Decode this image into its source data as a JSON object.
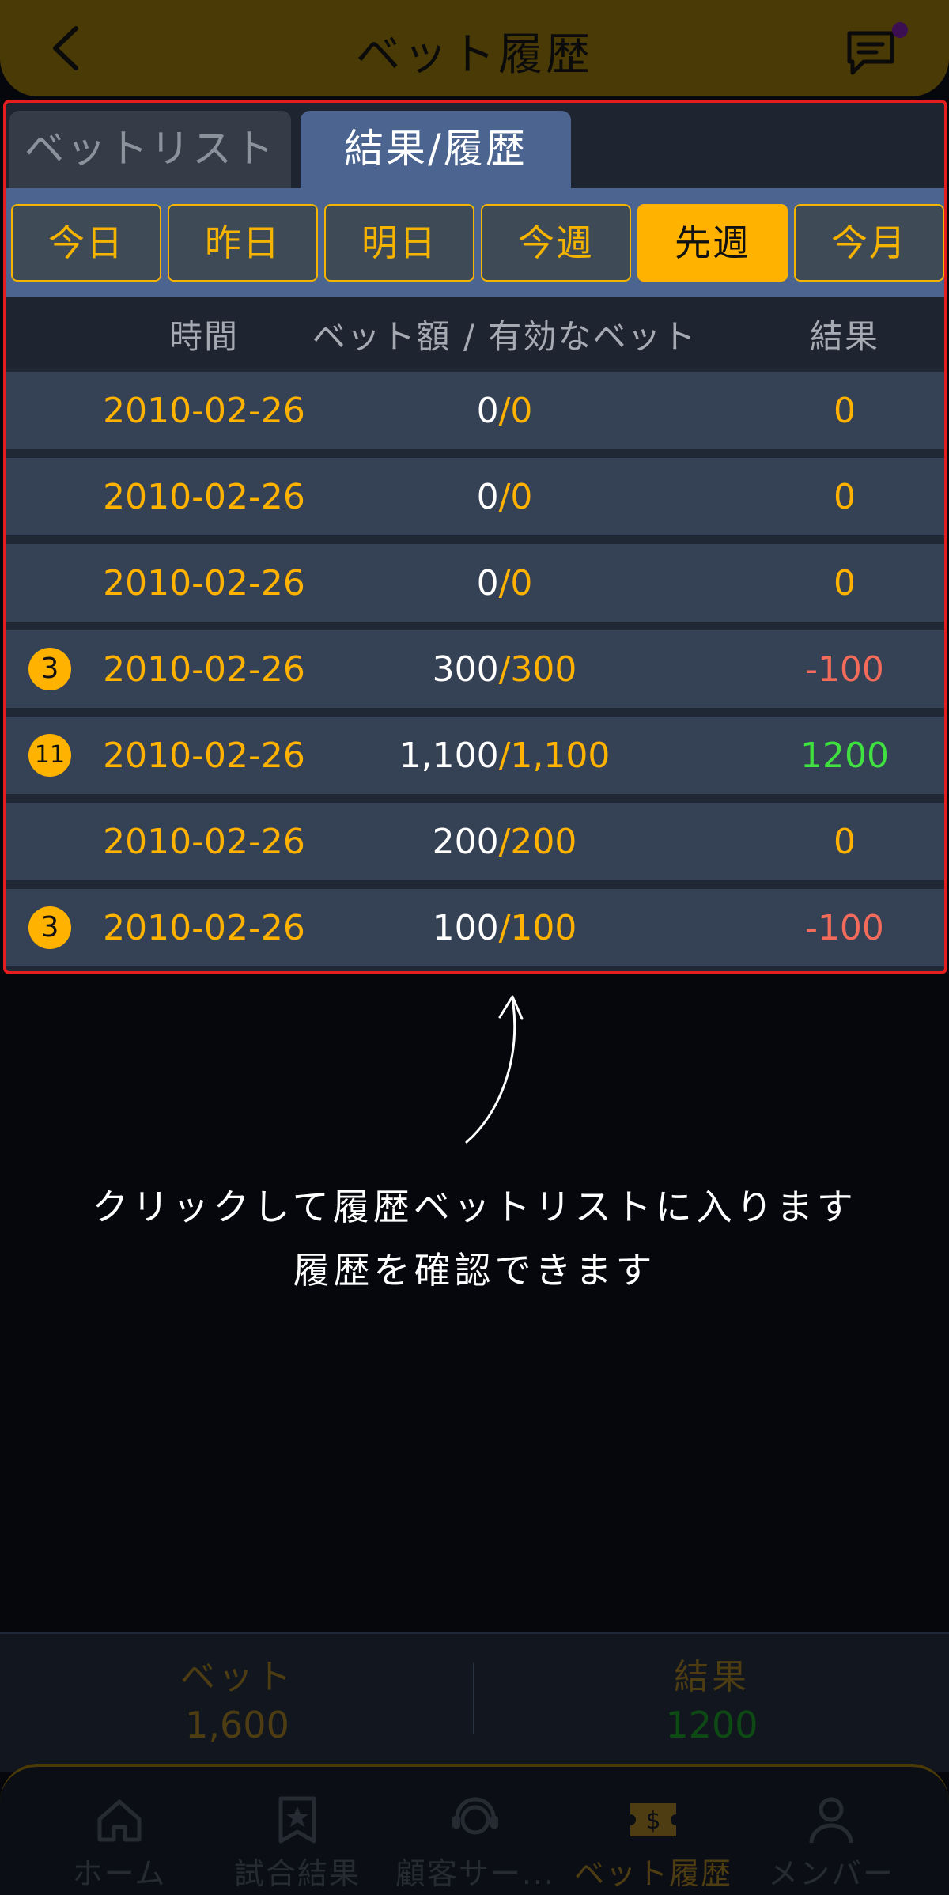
{
  "header": {
    "title": "ベット履歴"
  },
  "tabs": [
    {
      "label": "ベットリスト",
      "active": false
    },
    {
      "label": "結果/履歴",
      "active": true
    }
  ],
  "filters": [
    {
      "label": "今日",
      "active": false
    },
    {
      "label": "昨日",
      "active": false
    },
    {
      "label": "明日",
      "active": false
    },
    {
      "label": "今週",
      "active": false
    },
    {
      "label": "先週",
      "active": true
    },
    {
      "label": "今月",
      "active": false
    }
  ],
  "table": {
    "columns": {
      "time": "時間",
      "amount": "ベット額 / 有効なベット",
      "result": "結果"
    },
    "rows": [
      {
        "badge": "",
        "date": "2010-02-26",
        "total": "0",
        "valid": "0",
        "result": "0",
        "result_color": "#ffb300"
      },
      {
        "badge": "",
        "date": "2010-02-26",
        "total": "0",
        "valid": "0",
        "result": "0",
        "result_color": "#ffb300"
      },
      {
        "badge": "",
        "date": "2010-02-26",
        "total": "0",
        "valid": "0",
        "result": "0",
        "result_color": "#ffb300"
      },
      {
        "badge": "3",
        "date": "2010-02-26",
        "total": "300",
        "valid": "300",
        "result": "-100",
        "result_color": "#f26b5b"
      },
      {
        "badge": "11",
        "date": "2010-02-26",
        "total": "1,100",
        "valid": "1,100",
        "result": "1200",
        "result_color": "#3fe03f"
      },
      {
        "badge": "",
        "date": "2010-02-26",
        "total": "200",
        "valid": "200",
        "result": "0",
        "result_color": "#ffb300"
      },
      {
        "badge": "3",
        "date": "2010-02-26",
        "total": "100",
        "valid": "100",
        "result": "-100",
        "result_color": "#f26b5b"
      }
    ]
  },
  "hint": {
    "line1": "クリックして履歴ベットリストに入ります",
    "line2": "履歴を確認できます"
  },
  "summary": {
    "bet_label": "ベット",
    "bet_value": "1,600",
    "bet_color": "#4e3d12",
    "result_label": "結果",
    "result_value": "1200",
    "result_color": "#0e4a14"
  },
  "nav": [
    {
      "label": "ホーム",
      "icon": "home-icon",
      "active": false
    },
    {
      "label": "試合結果",
      "icon": "star-bookmark-icon",
      "active": false
    },
    {
      "label": "顧客サー...",
      "icon": "headset-icon",
      "active": false
    },
    {
      "label": "ベット履歴",
      "icon": "ticket-dollar-icon",
      "active": true
    },
    {
      "label": "メンバー",
      "icon": "user-icon",
      "active": false
    }
  ],
  "colors": {
    "accent": "#ffb300",
    "panel_border": "#e41e1e",
    "tab_active": "#4b6490"
  }
}
